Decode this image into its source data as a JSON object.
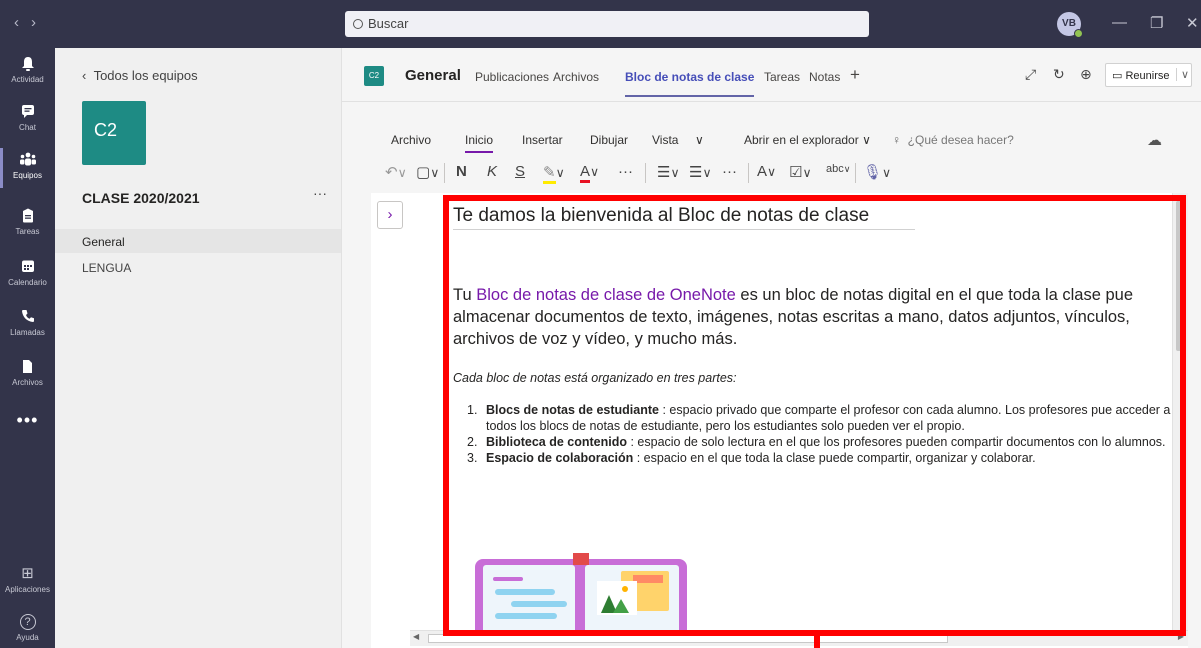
{
  "titlebar": {
    "back": "‹",
    "forward": "›",
    "search_placeholder": "Buscar",
    "avatar_initials": "VB",
    "minimize": "—",
    "restore": "❐",
    "close": "✕"
  },
  "rail": {
    "items": [
      {
        "label": "Actividad",
        "icon": "bell-icon",
        "glyph": "🔔"
      },
      {
        "label": "Chat",
        "icon": "chat-icon",
        "glyph": "▤"
      },
      {
        "label": "Equipos",
        "icon": "teams-icon",
        "glyph": "⁂"
      },
      {
        "label": "Tareas",
        "icon": "assignments-icon",
        "glyph": "▣"
      },
      {
        "label": "Calendario",
        "icon": "calendar-icon",
        "glyph": "▦"
      },
      {
        "label": "Llamadas",
        "icon": "phone-icon",
        "glyph": "✆"
      },
      {
        "label": "Archivos",
        "icon": "files-icon",
        "glyph": "▮"
      }
    ],
    "more": "•••",
    "apps_label": "Aplicaciones",
    "apps_glyph": "⊞",
    "help_label": "Ayuda",
    "help_glyph": "?"
  },
  "team": {
    "back_label": "Todos los equipos",
    "tile": "C2",
    "name": "CLASE 2020/2021",
    "more": "···",
    "channels": [
      "General",
      "LENGUA"
    ]
  },
  "channel": {
    "tile": "C2",
    "name": "General",
    "tabs": [
      "Publicaciones",
      "Archivos",
      "Bloc de notas de clase",
      "Tareas",
      "Notas"
    ],
    "add": "+",
    "meet_label": "Reunirse",
    "meet_chevron": "∨"
  },
  "ribbon": {
    "tabs": [
      "Archivo",
      "Inicio",
      "Insertar",
      "Dibujar",
      "Vista"
    ],
    "more": "∨",
    "open_explorer": "Abrir en el explorador",
    "tell_me": "¿Qué desea hacer?"
  },
  "page": {
    "title": "Te damos la bienvenida al Bloc de notas de clase",
    "intro_link": "Bloc de notas de clase de OneNote",
    "intro_before": "Tu ",
    "intro_after": " es un bloc de notas digital en el que toda la clase pue almacenar documentos de texto, imágenes, notas escritas a mano, datos adjuntos, vínculos, archivos de voz y vídeo, y mucho más.",
    "organized": "Cada bloc de notas está organizado en tres partes:",
    "items": [
      {
        "num": "1.",
        "bold": "Blocs de notas de estudiante",
        "text": " : espacio privado que comparte el profesor con cada alumno. Los profesores pue acceder a todos los blocs de notas de estudiante, pero los estudiantes solo pueden ver el propio."
      },
      {
        "num": "2.",
        "bold": "Biblioteca de contenido",
        "text": " : espacio de solo lectura en el que los profesores pueden compartir documentos con lo alumnos."
      },
      {
        "num": "3.",
        "bold": "Espacio de colaboración",
        "text": " : espacio en el que toda la clase puede compartir, organizar y colaborar."
      }
    ]
  },
  "colors": {
    "rail": "#33344a",
    "accent": "#6264a7",
    "onenote": "#7719aa",
    "team_tile": "#1e8b84",
    "annotation": "#ff0000"
  }
}
